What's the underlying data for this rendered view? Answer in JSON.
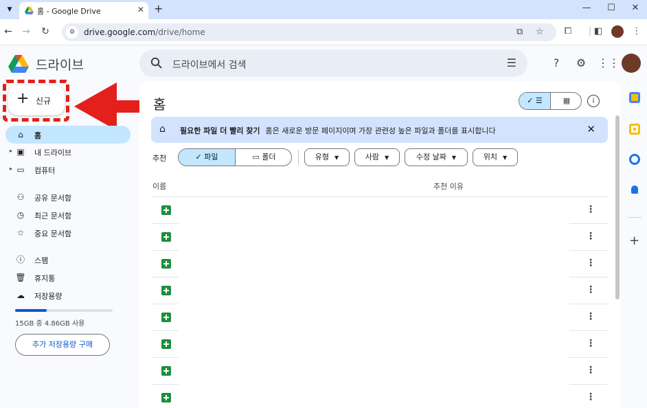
{
  "browser": {
    "tab_title": "홈 - Google Drive",
    "url_domain": "drive.google.com",
    "url_path": "/drive/home"
  },
  "header": {
    "brand": "드라이브",
    "search_placeholder": "드라이브에서 검색"
  },
  "sidebar": {
    "new_label": "신규",
    "items": [
      {
        "label": "홈",
        "icon": "home-icon",
        "active": true
      },
      {
        "label": "내 드라이브",
        "icon": "my-drive-icon",
        "expandable": true
      },
      {
        "label": "컴퓨터",
        "icon": "computer-icon",
        "expandable": true
      },
      {
        "label": "공유 문서함",
        "icon": "shared-icon"
      },
      {
        "label": "최근 문서함",
        "icon": "clock-icon"
      },
      {
        "label": "중요 문서함",
        "icon": "star-icon"
      },
      {
        "label": "스팸",
        "icon": "spam-icon"
      },
      {
        "label": "휴지통",
        "icon": "trash-icon"
      },
      {
        "label": "저장용량",
        "icon": "cloud-icon"
      }
    ],
    "storage_text": "15GB 중 4.86GB 사용",
    "storage_used_fraction": 0.324,
    "buy_label": "추가 저장용량 구매"
  },
  "main": {
    "title": "홈",
    "banner_title": "필요한 파일 더 빨리 찾기",
    "banner_text": "홈은 새로운 방문 페이지이며 가장 관련성 높은 파일과 폴더를 표시합니다",
    "filter_label": "추천",
    "segment_files": "✓ 파일",
    "segment_folders": "폴더",
    "chips": [
      "유형",
      "사람",
      "수정 날짜",
      "위치"
    ],
    "col_name": "이름",
    "col_reason": "추천 이유",
    "rows": 8
  },
  "colors": {
    "accent": "#0b57d0",
    "active_nav": "#c2e7ff",
    "banner": "#d3e3fd",
    "annotation_red": "#e3201c",
    "sheets_green": "#1e8e3e"
  }
}
